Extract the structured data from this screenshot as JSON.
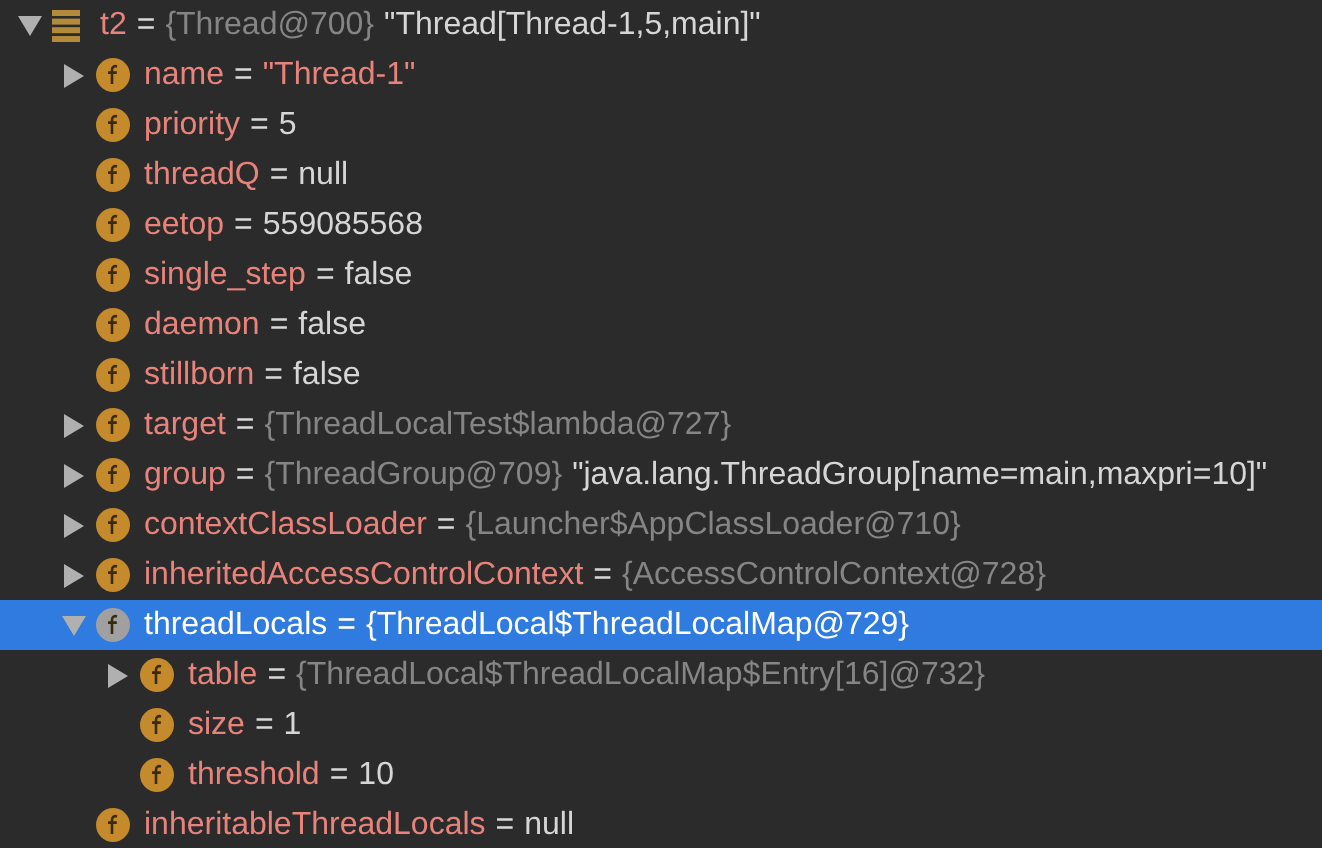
{
  "variables": [
    {
      "kind": "local",
      "name": "t2",
      "sign": "=",
      "expandable": true,
      "expanded": true,
      "selected": false,
      "ref": "{Thread@700}",
      "value": {
        "kind": "plain",
        "text": "\"Thread[Thread-1,5,main]\""
      },
      "children": [
        {
          "kind": "field",
          "name": "name",
          "sign": "=",
          "expandable": true,
          "expanded": false,
          "selected": false,
          "value": {
            "kind": "string",
            "text": "\"Thread-1\""
          }
        },
        {
          "kind": "field",
          "name": "priority",
          "sign": "=",
          "expandable": false,
          "selected": false,
          "value": {
            "kind": "plain",
            "text": "5"
          }
        },
        {
          "kind": "field",
          "name": "threadQ",
          "sign": "=",
          "expandable": false,
          "selected": false,
          "value": {
            "kind": "plain",
            "text": "null"
          }
        },
        {
          "kind": "field",
          "name": "eetop",
          "sign": "=",
          "expandable": false,
          "selected": false,
          "value": {
            "kind": "plain",
            "text": "559085568"
          }
        },
        {
          "kind": "field",
          "name": "single_step",
          "sign": "=",
          "expandable": false,
          "selected": false,
          "value": {
            "kind": "plain",
            "text": "false"
          }
        },
        {
          "kind": "field",
          "name": "daemon",
          "sign": "=",
          "expandable": false,
          "selected": false,
          "value": {
            "kind": "plain",
            "text": "false"
          }
        },
        {
          "kind": "field",
          "name": "stillborn",
          "sign": "=",
          "expandable": false,
          "selected": false,
          "value": {
            "kind": "plain",
            "text": "false"
          }
        },
        {
          "kind": "field",
          "name": "target",
          "sign": "=",
          "expandable": true,
          "expanded": false,
          "selected": false,
          "ref": "{ThreadLocalTest$lambda@727}"
        },
        {
          "kind": "field",
          "name": "group",
          "sign": "=",
          "expandable": true,
          "expanded": false,
          "selected": false,
          "ref": "{ThreadGroup@709}",
          "value": {
            "kind": "plain",
            "text": "\"java.lang.ThreadGroup[name=main,maxpri=10]\""
          }
        },
        {
          "kind": "field",
          "name": "contextClassLoader",
          "sign": "=",
          "expandable": true,
          "expanded": false,
          "selected": false,
          "ref": "{Launcher$AppClassLoader@710}"
        },
        {
          "kind": "field",
          "name": "inheritedAccessControlContext",
          "sign": "=",
          "expandable": true,
          "expanded": false,
          "selected": false,
          "ref": "{AccessControlContext@728}"
        },
        {
          "kind": "field",
          "name": "threadLocals",
          "sign": "=",
          "expandable": true,
          "expanded": true,
          "selected": true,
          "ref": "{ThreadLocal$ThreadLocalMap@729}",
          "children": [
            {
              "kind": "field",
              "name": "table",
              "sign": "=",
              "expandable": true,
              "expanded": false,
              "selected": false,
              "ref": "{ThreadLocal$ThreadLocalMap$Entry[16]@732}"
            },
            {
              "kind": "field",
              "name": "size",
              "sign": "=",
              "expandable": false,
              "selected": false,
              "value": {
                "kind": "plain",
                "text": "1"
              }
            },
            {
              "kind": "field",
              "name": "threshold",
              "sign": "=",
              "expandable": false,
              "selected": false,
              "value": {
                "kind": "plain",
                "text": "10"
              }
            }
          ]
        },
        {
          "kind": "field",
          "name": "inheritableThreadLocals",
          "sign": "=",
          "expandable": false,
          "selected": false,
          "value": {
            "kind": "plain",
            "text": "null"
          }
        }
      ]
    }
  ]
}
